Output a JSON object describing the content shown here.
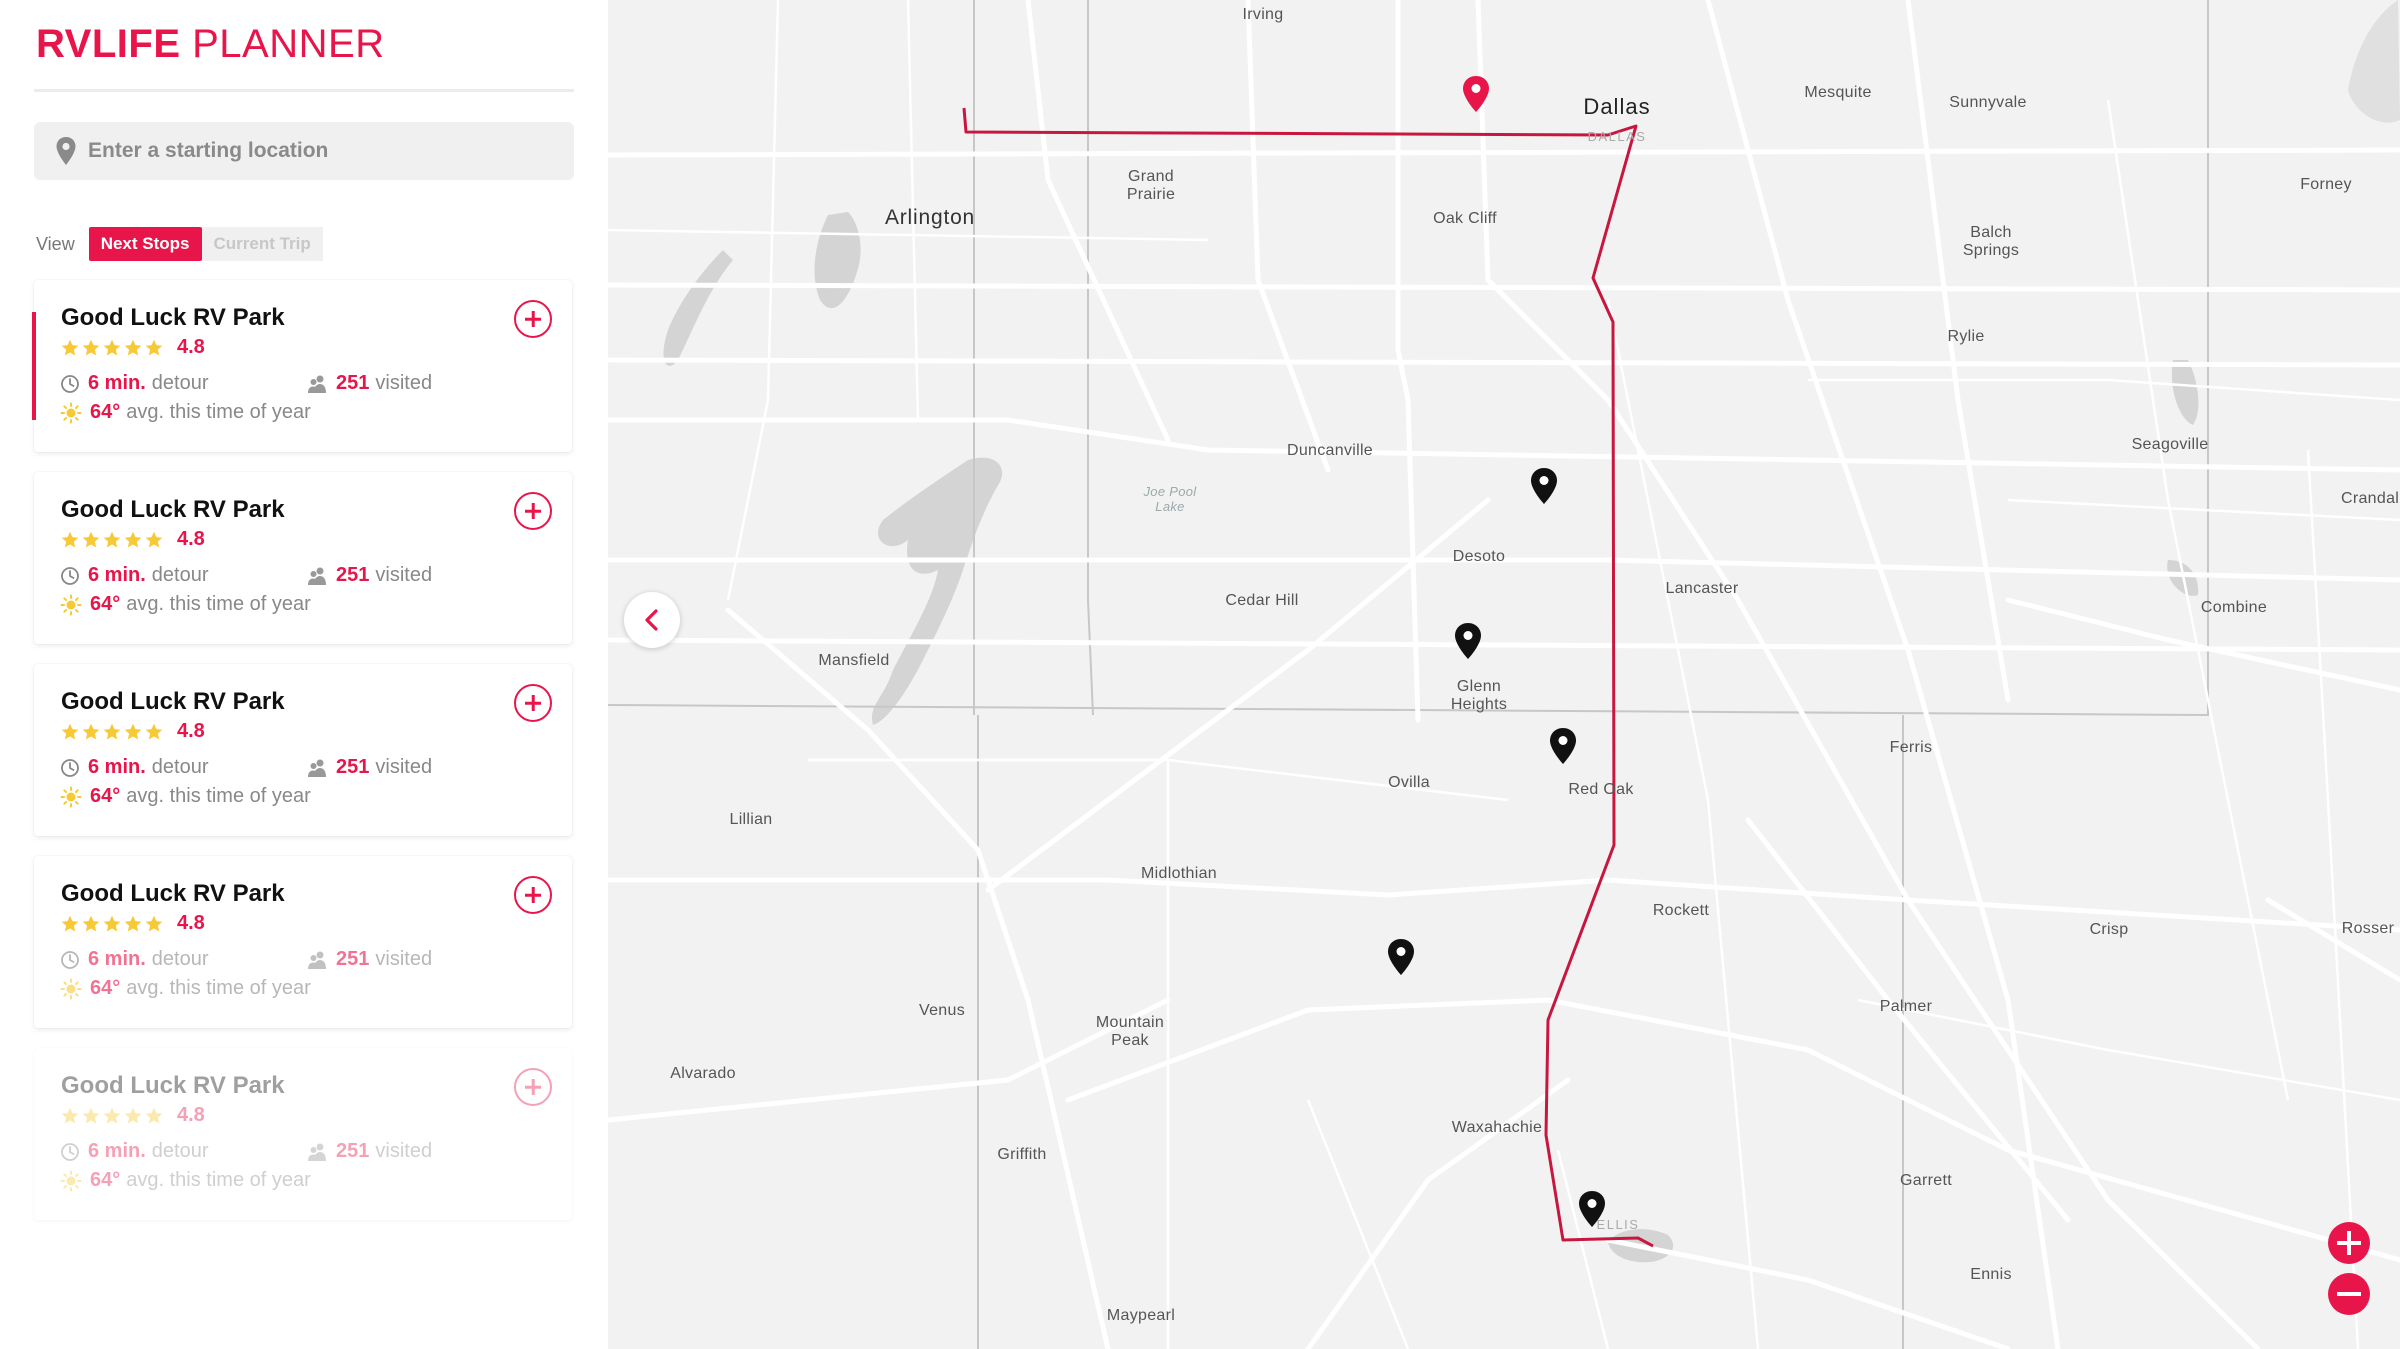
{
  "brand": {
    "bold": "RVLIFE",
    "light": " PLANNER",
    "accent_color": "#e8154a"
  },
  "search": {
    "placeholder": "Enter a starting location",
    "value": ""
  },
  "view": {
    "label": "View",
    "tabs": [
      "Next Stops",
      "Current Trip"
    ],
    "active": "Next Stops"
  },
  "stops": [
    {
      "name": "Good Luck RV Park",
      "rating": "4.8",
      "stars": 5,
      "detour": "6 min.",
      "detour_suffix": "detour",
      "visited": "251",
      "visited_suffix": "visited",
      "temp": "64°",
      "temp_suffix": "avg. this time of year"
    },
    {
      "name": "Good Luck RV Park",
      "rating": "4.8",
      "stars": 5,
      "detour": "6 min.",
      "detour_suffix": "detour",
      "visited": "251",
      "visited_suffix": "visited",
      "temp": "64°",
      "temp_suffix": "avg. this time of year"
    },
    {
      "name": "Good Luck RV Park",
      "rating": "4.8",
      "stars": 5,
      "detour": "6 min.",
      "detour_suffix": "detour",
      "visited": "251",
      "visited_suffix": "visited",
      "temp": "64°",
      "temp_suffix": "avg. this time of year"
    },
    {
      "name": "Good Luck RV Park",
      "rating": "4.8",
      "stars": 5,
      "detour": "6 min.",
      "detour_suffix": "detour",
      "visited": "251",
      "visited_suffix": "visited",
      "temp": "64°",
      "temp_suffix": "avg. this time of year"
    },
    {
      "name": "Good Luck RV Park",
      "rating": "4.8",
      "stars": 5,
      "detour": "6 min.",
      "detour_suffix": "detour",
      "visited": "251",
      "visited_suffix": "visited",
      "temp": "64°",
      "temp_suffix": "avg. this time of year"
    }
  ],
  "map": {
    "places": {
      "irving": "Irving",
      "dallas": "Dallas",
      "dallas_county": "DALLAS",
      "mesquite": "Mesquite",
      "sunnyvale": "Sunnyvale",
      "forney": "Forney",
      "grand_prairie": "Grand\nPrairie",
      "arlington": "Arlington",
      "oak_cliff": "Oak Cliff",
      "balch_springs": "Balch\nSprings",
      "rylie": "Rylie",
      "duncanville": "Duncanville",
      "seagoville": "Seagoville",
      "crandall": "Crandall",
      "joe_pool_lake": "Joe Pool\nLake",
      "desoto": "Desoto",
      "lancaster": "Lancaster",
      "cedar_hill": "Cedar Hill",
      "combine": "Combine",
      "mansfield": "Mansfield",
      "glenn_heights": "Glenn\nHeights",
      "ferris": "Ferris",
      "ovilla": "Ovilla",
      "red_oak": "Red Oak",
      "lillian": "Lillian",
      "midlothian": "Midlothian",
      "rockett": "Rockett",
      "crisp": "Crisp",
      "rosser": "Rosser",
      "venus": "Venus",
      "mountain_peak": "Mountain\nPeak",
      "palmer": "Palmer",
      "alvarado": "Alvarado",
      "waxahachie": "Waxahachie",
      "griffith": "Griffith",
      "garrett": "Garrett",
      "ellis": "ELLIS",
      "ennis": "Ennis",
      "maypearl": "Maypearl"
    },
    "route_color": "#c8173f",
    "start_marker_color": "#e8154a",
    "stop_marker_color": "#111111"
  }
}
